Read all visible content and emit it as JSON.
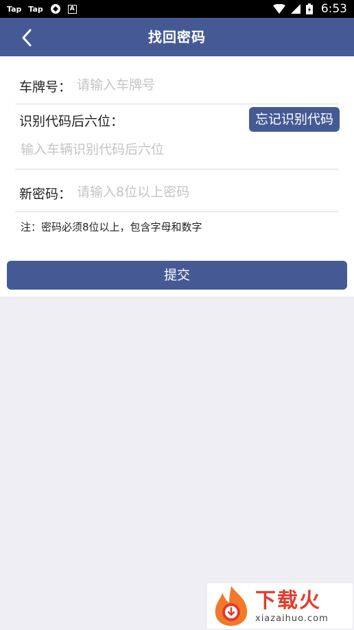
{
  "status_bar": {
    "left_labels": [
      "Tap",
      "Tap"
    ],
    "time": "6:53"
  },
  "header": {
    "title": "找回密码"
  },
  "form": {
    "plate": {
      "label": "车牌号：",
      "placeholder": "请输入车牌号",
      "value": ""
    },
    "vin": {
      "label": "识别代码后六位：",
      "placeholder": "输入车辆识别代码后六位",
      "value": "",
      "forget_label": "忘记识别代码"
    },
    "password": {
      "label": "新密码：",
      "placeholder": "请输入8位以上密码",
      "value": ""
    },
    "note": "注：密码必须8位以上，包含字母和数字",
    "submit_label": "提交"
  },
  "watermark": {
    "brand": "下载火",
    "domain": "xiazaihuo.com"
  },
  "colors": {
    "primary": "#455a95",
    "background": "#efeef3",
    "placeholder": "#c4c4c8",
    "watermark_red": "#e23a2b"
  }
}
